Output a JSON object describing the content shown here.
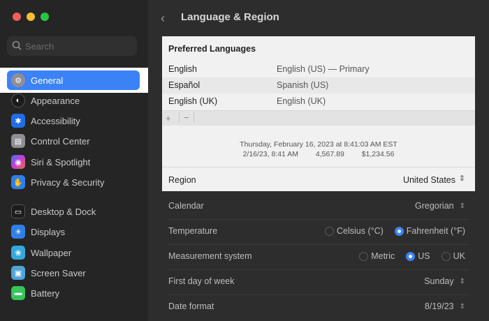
{
  "colors": {
    "accent": "#3b82f6",
    "close": "#ee5f57",
    "minimize": "#f5bf2e",
    "zoom": "#27c840"
  },
  "search": {
    "placeholder": "Search"
  },
  "sidebar": {
    "items": [
      {
        "label": "General",
        "icon": "gear-icon",
        "color": "#8e8e93",
        "selected": true
      },
      {
        "label": "Appearance",
        "icon": "appearance-icon",
        "color": "#1c1c1c"
      },
      {
        "label": "Accessibility",
        "icon": "accessibility-icon",
        "color": "#1e6ee6"
      },
      {
        "label": "Control Center",
        "icon": "control-center-icon",
        "color": "#8e8e93"
      },
      {
        "label": "Siri & Spotlight",
        "icon": "siri-icon",
        "color": "#c23fd6"
      },
      {
        "label": "Privacy & Security",
        "icon": "hand-icon",
        "color": "#2f7fe8"
      },
      {
        "label": "Desktop & Dock",
        "icon": "dock-icon",
        "color": "#1c1c1c"
      },
      {
        "label": "Displays",
        "icon": "display-icon",
        "color": "#2f7fe8"
      },
      {
        "label": "Wallpaper",
        "icon": "wallpaper-icon",
        "color": "#34aadc"
      },
      {
        "label": "Screen Saver",
        "icon": "screen-saver-icon",
        "color": "#4fa3d9"
      },
      {
        "label": "Battery",
        "icon": "battery-icon",
        "color": "#34c759"
      }
    ]
  },
  "header": {
    "back": "‹",
    "title": "Language & Region"
  },
  "preferred": {
    "title": "Preferred Languages",
    "languages": [
      {
        "name": "English",
        "value": "English (US) — Primary"
      },
      {
        "name": "Español",
        "value": "Spanish (US)"
      },
      {
        "name": "English (UK)",
        "value": "English (UK)"
      }
    ],
    "add": "+",
    "remove": "−",
    "sample_line1": "Thursday, February 16, 2023 at 8:41:03 AM EST",
    "sample_date": "2/16/23, 8:41 AM",
    "sample_number": "4,567.89",
    "sample_currency": "$1,234.56"
  },
  "region": {
    "label": "Region",
    "value": "United States"
  },
  "settings": {
    "calendar": {
      "label": "Calendar",
      "value": "Gregorian"
    },
    "temperature": {
      "label": "Temperature",
      "options": [
        "Celsius (°C)",
        "Fahrenheit (°F)"
      ],
      "selected": "Fahrenheit (°F)"
    },
    "measurement": {
      "label": "Measurement system",
      "options": [
        "Metric",
        "US",
        "UK"
      ],
      "selected": "US"
    },
    "first_day": {
      "label": "First day of week",
      "value": "Sunday"
    },
    "date_format": {
      "label": "Date format",
      "value": "8/19/23"
    }
  }
}
